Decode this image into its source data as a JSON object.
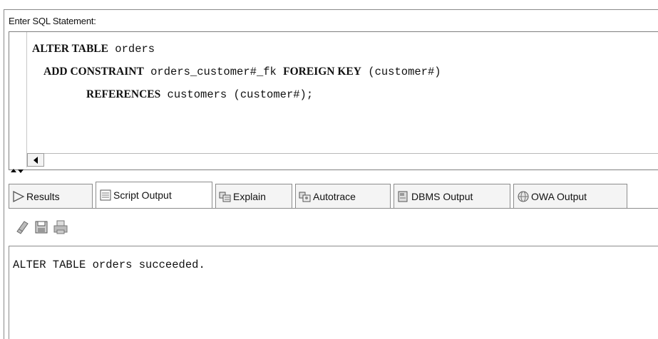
{
  "editor": {
    "label": "Enter SQL Statement:",
    "lines": [
      {
        "kw1": "ALTER TABLE",
        "rest1": " orders",
        "kw2": "",
        "rest2": ""
      },
      {
        "kw1": "ADD CONSTRAINT",
        "rest1": " orders_customer#_fk ",
        "kw2": "FOREIGN KEY",
        "rest2": " (customer#)"
      },
      {
        "kw1": "REFERENCES",
        "rest1": " customers (customer#);",
        "kw2": "",
        "rest2": ""
      }
    ]
  },
  "tabs": [
    {
      "label": "Results",
      "icon": "play-icon"
    },
    {
      "label": "Script Output",
      "icon": "script-icon"
    },
    {
      "label": "Explain",
      "icon": "explain-icon"
    },
    {
      "label": "Autotrace",
      "icon": "autotrace-icon"
    },
    {
      "label": "DBMS Output",
      "icon": "dbms-icon"
    },
    {
      "label": "OWA Output",
      "icon": "owa-icon"
    }
  ],
  "active_tab": "Script Output",
  "toolbar": {
    "icons": [
      "eraser-icon",
      "save-icon",
      "print-icon"
    ]
  },
  "output": {
    "text": "ALTER TABLE orders succeeded."
  }
}
